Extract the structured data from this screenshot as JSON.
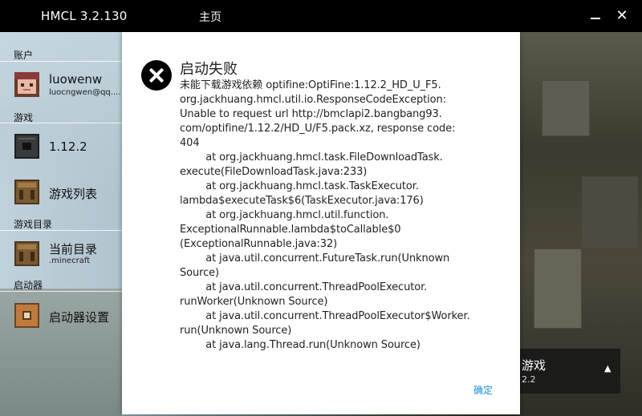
{
  "titlebar": {
    "app_title": "HMCL 3.2.130",
    "page_title": "主页",
    "minimize_icon": "minimize-icon",
    "close_icon": "close-icon",
    "close_glyph": "✕"
  },
  "sidebar": {
    "account_section": "账户",
    "account": {
      "name": "luowenw",
      "email": "luocngwen@qq...."
    },
    "game_section": "游戏",
    "game_version": "1.12.2",
    "game_list": "游戏列表",
    "dir_section": "游戏目录",
    "current_dir": "当前目录",
    "current_dir_sub": ".minecraft",
    "launcher_section": "启动器",
    "launcher_settings": "启动器设置"
  },
  "launch": {
    "title": "游戏",
    "version": "2.2",
    "arrow": "▲"
  },
  "dialog": {
    "icon": "error-icon",
    "title": "启动失败",
    "message": "未能下载游戏依赖 optifine:OptiFine:1.12.2_HD_U_F5.\norg.jackhuang.hmcl.util.io.ResponseCodeException:\nUnable to request url http://bmclapi2.bangbang93.\ncom/optifine/1.12.2/HD_U/F5.pack.xz, response code:\n404\n        at org.jackhuang.hmcl.task.FileDownloadTask.\nexecute(FileDownloadTask.java:233)\n        at org.jackhuang.hmcl.task.TaskExecutor.\nlambda$executeTask$6(TaskExecutor.java:176)\n        at org.jackhuang.hmcl.util.function.\nExceptionalRunnable.lambda$toCallable$0\n(ExceptionalRunnable.java:32)\n        at java.util.concurrent.FutureTask.run(Unknown\nSource)\n        at java.util.concurrent.ThreadPoolExecutor.\nrunWorker(Unknown Source)\n        at java.util.concurrent.ThreadPoolExecutor$Worker.\nrun(Unknown Source)\n        at java.lang.Thread.run(Unknown Source)",
    "ok_label": "确定"
  },
  "colors": {
    "accent": "#1a8fd0",
    "titlebar": "#000000",
    "dialog_bg": "#ffffff"
  }
}
